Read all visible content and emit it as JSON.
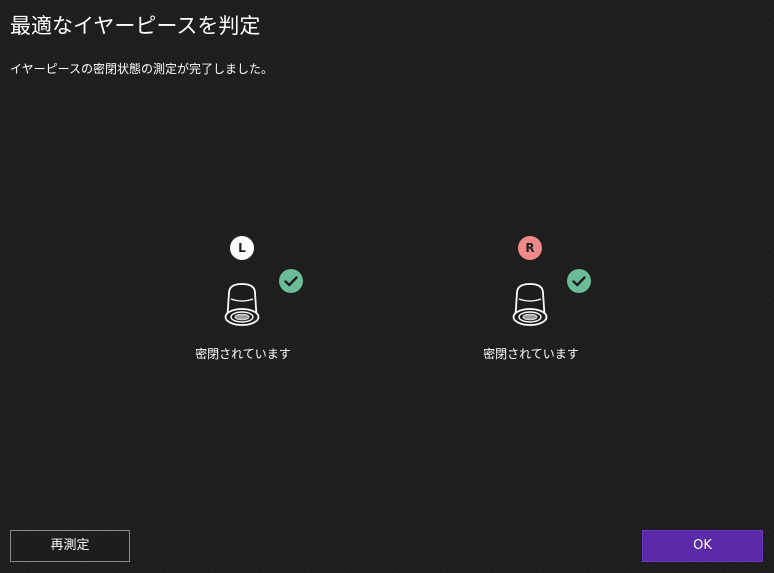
{
  "dialog": {
    "title": "最適なイヤーピースを判定",
    "subtitle": "イヤーピースの密閉状態の測定が完了しました。"
  },
  "earbuds": {
    "left": {
      "side_label": "L",
      "status": "密閉されています",
      "badge_color": "#ffffff",
      "check_color": "#6bbd98"
    },
    "right": {
      "side_label": "R",
      "status": "密閉されています",
      "badge_color": "#f08a8a",
      "check_color": "#6bbd98"
    }
  },
  "buttons": {
    "retest_label": "再測定",
    "ok_label": "OK"
  },
  "colors": {
    "background": "#1d1d1d",
    "accent": "#5b2aa8"
  }
}
